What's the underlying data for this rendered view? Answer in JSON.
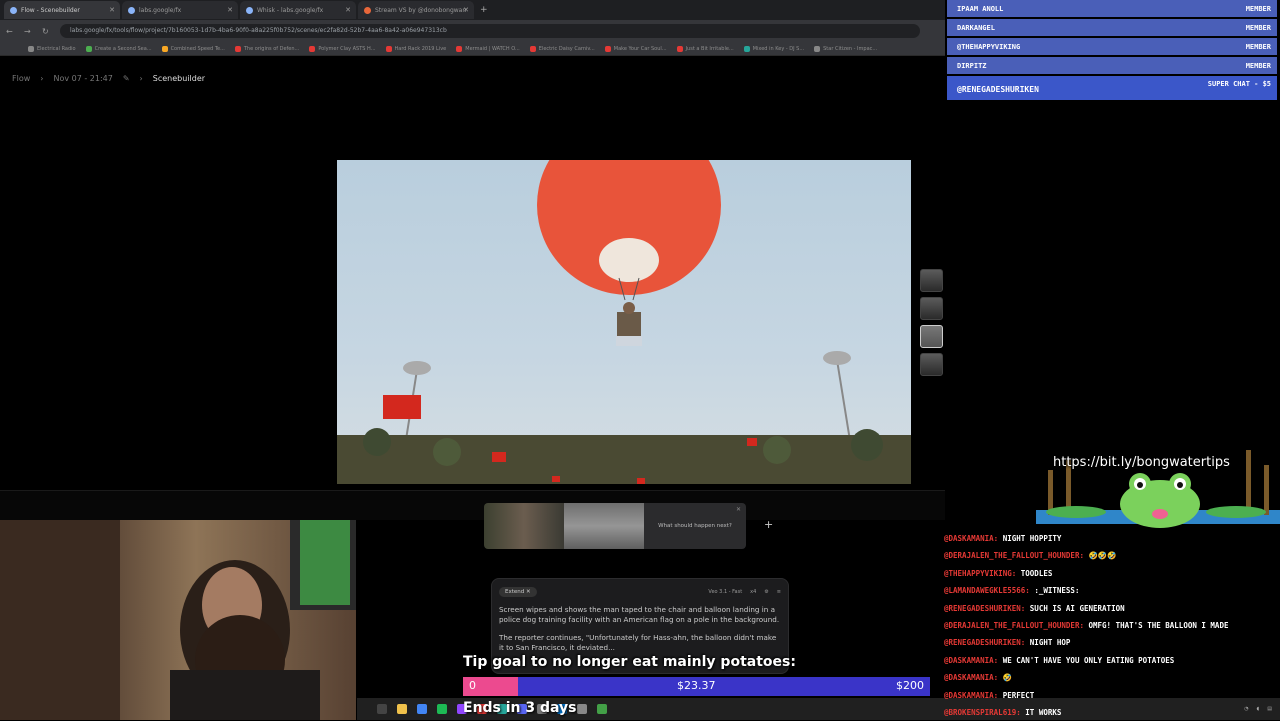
{
  "browser": {
    "tabs": [
      {
        "title": "Flow - Scenebuilder",
        "active": true
      },
      {
        "title": "labs.google/fx",
        "active": false
      },
      {
        "title": "Whisk - labs.google/fx",
        "active": false
      },
      {
        "title": "Stream VS by @donobongwan",
        "active": false
      }
    ],
    "url": "labs.google/fx/tools/flow/project/7b160053-1d7b-4ba6-90f0-a8a225f0b752/scenes/ec2fa82d-52b7-4aa6-8a42-a06e947313cb",
    "bookmarks": [
      "Electrical Radio",
      "Create a Second Sea...",
      "Combined Speed Te...",
      "The origins of Defen...",
      "Polymer Clay ASTS H...",
      "Hard Rack 2019 Live",
      "Mermaid | WATCH O...",
      "Electric Daisy Carniv...",
      "Make Your Car Soul...",
      "Just a Bit Irritable...",
      "Mixed in Key - DJ S...",
      "Star Citizen - Impac..."
    ]
  },
  "app": {
    "breadcrumb": {
      "root": "Flow",
      "date": "Nov 07 - 21:47",
      "current": "Scenebuilder"
    },
    "clip_prompt": "What should happen next?",
    "prompt_panel": {
      "chip": "Extend",
      "model": "Veo 3.1 - Fast",
      "count": "x4",
      "text1": "Screen wipes and shows the man taped to the chair and balloon landing in a police dog training facility with an American flag on a pole in the background.",
      "text2": "The reporter continues, \"Unfortunately for Hass-ahn, the balloon didn't make it to San Francisco, it deviated..."
    }
  },
  "overlay": {
    "tip_goal": "Tip goal to no longer eat mainly potatoes:",
    "goal_start": "0",
    "goal_current": "$23.37",
    "goal_target": "$200",
    "goal_progress": 0.1169,
    "ends_in": "Ends in 3 days",
    "link": "https://bit.ly/bongwatertips"
  },
  "members": [
    {
      "name": "IPAAM ANOLL",
      "badge": "MEMBER"
    },
    {
      "name": "DARKANGEL",
      "badge": "MEMBER"
    },
    {
      "name": "@THEHAPPYVIKING",
      "badge": "MEMBER"
    },
    {
      "name": "DIRPITZ",
      "badge": "MEMBER"
    },
    {
      "name": "@RENEGADESHURIKEN",
      "badge": "SUPER CHAT - $5"
    }
  ],
  "chat": [
    {
      "user": "@DASKAMANIA:",
      "msg": "NIGHT HOPPITY"
    },
    {
      "user": "@DERAJALEN_THE_FALLOUT_HOUNDER:",
      "msg": "🤣🤣🤣"
    },
    {
      "user": "@THEHAPPYVIKING:",
      "msg": "TOODLES"
    },
    {
      "user": "@LAMANDAWEGKLE5566:",
      "msg": ":_WITNESS:"
    },
    {
      "user": "@RENEGADESHURIKEN:",
      "msg": "SUCH IS AI GENERATION"
    },
    {
      "user": "@DERAJALEN_THE_FALLOUT_HOUNDER:",
      "msg": "OMFG! THAT'S THE BALLOON I MADE"
    },
    {
      "user": "@RENEGADESHURIKEN:",
      "msg": "NIGHT HOP"
    },
    {
      "user": "@DASKAMANIA:",
      "msg": "WE CAN'T HAVE YOU ONLY EATING POTATOES"
    },
    {
      "user": "@DASKAMANIA:",
      "msg": "🤣"
    },
    {
      "user": "@DASKAMANIA:",
      "msg": "PERFECT"
    },
    {
      "user": "@BROKENSPIRAL619:",
      "msg": "IT WORKS"
    }
  ],
  "colors": {
    "member_bg": "#4a5fb8",
    "goal_bar": "#3a34c8",
    "goal_fill": "#ec4a8f",
    "chat_name": "#e53935"
  }
}
